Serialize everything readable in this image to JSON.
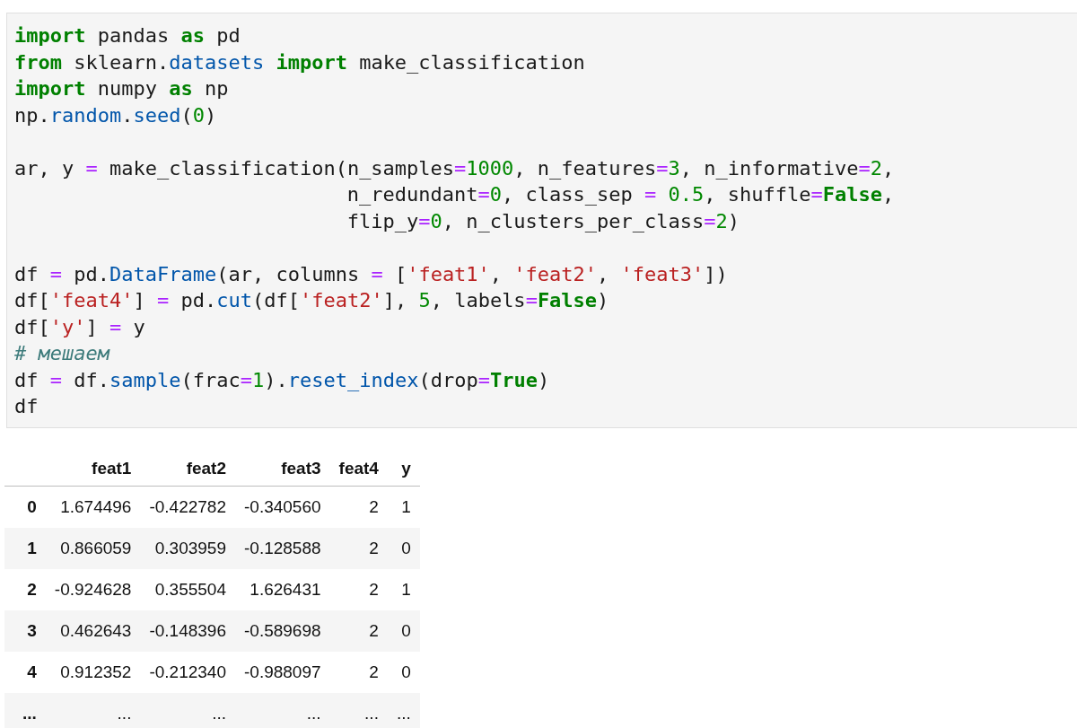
{
  "code_cell": {
    "blocks": [
      [
        [
          {
            "kind": "keyword",
            "text": "import"
          },
          {
            "kind": "plain",
            "text": " pandas "
          },
          {
            "kind": "keyword",
            "text": "as"
          },
          {
            "kind": "plain",
            "text": " pd"
          }
        ],
        [
          {
            "kind": "keyword",
            "text": "from"
          },
          {
            "kind": "plain",
            "text": " sklearn."
          },
          {
            "kind": "attribute",
            "text": "datasets"
          },
          {
            "kind": "keyword",
            "text": " import"
          },
          {
            "kind": "plain",
            "text": " make_classification"
          }
        ],
        [
          {
            "kind": "keyword",
            "text": "import"
          },
          {
            "kind": "plain",
            "text": " numpy "
          },
          {
            "kind": "keyword",
            "text": "as"
          },
          {
            "kind": "plain",
            "text": " np"
          }
        ],
        [
          {
            "kind": "plain",
            "text": "np."
          },
          {
            "kind": "attribute",
            "text": "random"
          },
          {
            "kind": "plain",
            "text": "."
          },
          {
            "kind": "attribute",
            "text": "seed"
          },
          {
            "kind": "plain",
            "text": "("
          },
          {
            "kind": "number",
            "text": "0"
          },
          {
            "kind": "plain",
            "text": ")"
          }
        ]
      ],
      [
        [
          {
            "kind": "plain",
            "text": "ar, y "
          },
          {
            "kind": "operator",
            "text": "="
          },
          {
            "kind": "plain",
            "text": " make_classification(n_samples"
          },
          {
            "kind": "operator",
            "text": "="
          },
          {
            "kind": "number",
            "text": "1000"
          },
          {
            "kind": "plain",
            "text": ", n_features"
          },
          {
            "kind": "operator",
            "text": "="
          },
          {
            "kind": "number",
            "text": "3"
          },
          {
            "kind": "plain",
            "text": ", n_informative"
          },
          {
            "kind": "operator",
            "text": "="
          },
          {
            "kind": "number",
            "text": "2"
          },
          {
            "kind": "plain",
            "text": ","
          }
        ],
        [
          {
            "kind": "plain",
            "text": "                            n_redundant"
          },
          {
            "kind": "operator",
            "text": "="
          },
          {
            "kind": "number",
            "text": "0"
          },
          {
            "kind": "plain",
            "text": ", class_sep "
          },
          {
            "kind": "operator",
            "text": "="
          },
          {
            "kind": "number",
            "text": " 0.5"
          },
          {
            "kind": "plain",
            "text": ", shuffle"
          },
          {
            "kind": "operator",
            "text": "="
          },
          {
            "kind": "keyword",
            "text": "False"
          },
          {
            "kind": "plain",
            "text": ","
          }
        ],
        [
          {
            "kind": "plain",
            "text": "                            flip_y"
          },
          {
            "kind": "operator",
            "text": "="
          },
          {
            "kind": "number",
            "text": "0"
          },
          {
            "kind": "plain",
            "text": ", n_clusters_per_class"
          },
          {
            "kind": "operator",
            "text": "="
          },
          {
            "kind": "number",
            "text": "2"
          },
          {
            "kind": "plain",
            "text": ")"
          }
        ]
      ],
      [
        [
          {
            "kind": "plain",
            "text": "df "
          },
          {
            "kind": "operator",
            "text": "="
          },
          {
            "kind": "plain",
            "text": " pd."
          },
          {
            "kind": "attribute",
            "text": "DataFrame"
          },
          {
            "kind": "plain",
            "text": "(ar, columns "
          },
          {
            "kind": "operator",
            "text": "="
          },
          {
            "kind": "plain",
            "text": " ["
          },
          {
            "kind": "string",
            "text": "'feat1'"
          },
          {
            "kind": "plain",
            "text": ", "
          },
          {
            "kind": "string",
            "text": "'feat2'"
          },
          {
            "kind": "plain",
            "text": ", "
          },
          {
            "kind": "string",
            "text": "'feat3'"
          },
          {
            "kind": "plain",
            "text": "])"
          }
        ],
        [
          {
            "kind": "plain",
            "text": "df["
          },
          {
            "kind": "string",
            "text": "'feat4'"
          },
          {
            "kind": "plain",
            "text": "] "
          },
          {
            "kind": "operator",
            "text": "="
          },
          {
            "kind": "plain",
            "text": " pd."
          },
          {
            "kind": "attribute",
            "text": "cut"
          },
          {
            "kind": "plain",
            "text": "(df["
          },
          {
            "kind": "string",
            "text": "'feat2'"
          },
          {
            "kind": "plain",
            "text": "], "
          },
          {
            "kind": "number",
            "text": "5"
          },
          {
            "kind": "plain",
            "text": ", labels"
          },
          {
            "kind": "operator",
            "text": "="
          },
          {
            "kind": "keyword",
            "text": "False"
          },
          {
            "kind": "plain",
            "text": ")"
          }
        ],
        [
          {
            "kind": "plain",
            "text": "df["
          },
          {
            "kind": "string",
            "text": "'y'"
          },
          {
            "kind": "plain",
            "text": "] "
          },
          {
            "kind": "operator",
            "text": "="
          },
          {
            "kind": "plain",
            "text": " y"
          }
        ],
        [
          {
            "kind": "comment",
            "text": "# мешаем"
          }
        ],
        [
          {
            "kind": "plain",
            "text": "df "
          },
          {
            "kind": "operator",
            "text": "="
          },
          {
            "kind": "plain",
            "text": " df."
          },
          {
            "kind": "attribute",
            "text": "sample"
          },
          {
            "kind": "plain",
            "text": "(frac"
          },
          {
            "kind": "operator",
            "text": "="
          },
          {
            "kind": "number",
            "text": "1"
          },
          {
            "kind": "plain",
            "text": ")."
          },
          {
            "kind": "attribute",
            "text": "reset_index"
          },
          {
            "kind": "plain",
            "text": "(drop"
          },
          {
            "kind": "operator",
            "text": "="
          },
          {
            "kind": "keyword",
            "text": "True"
          },
          {
            "kind": "plain",
            "text": ")"
          }
        ],
        [
          {
            "kind": "plain",
            "text": "df"
          }
        ]
      ]
    ]
  },
  "output_table": {
    "columns": [
      "feat1",
      "feat2",
      "feat3",
      "feat4",
      "y"
    ],
    "rows": [
      {
        "index": "0",
        "cells": [
          "1.674496",
          "-0.422782",
          "-0.340560",
          "2",
          "1"
        ]
      },
      {
        "index": "1",
        "cells": [
          "0.866059",
          "0.303959",
          "-0.128588",
          "2",
          "0"
        ]
      },
      {
        "index": "2",
        "cells": [
          "-0.924628",
          "0.355504",
          "1.626431",
          "2",
          "1"
        ]
      },
      {
        "index": "3",
        "cells": [
          "0.462643",
          "-0.148396",
          "-0.589698",
          "2",
          "0"
        ]
      },
      {
        "index": "4",
        "cells": [
          "0.912352",
          "-0.212340",
          "-0.988097",
          "2",
          "0"
        ]
      },
      {
        "index": "...",
        "cells": [
          "...",
          "...",
          "...",
          "...",
          "..."
        ]
      }
    ]
  }
}
